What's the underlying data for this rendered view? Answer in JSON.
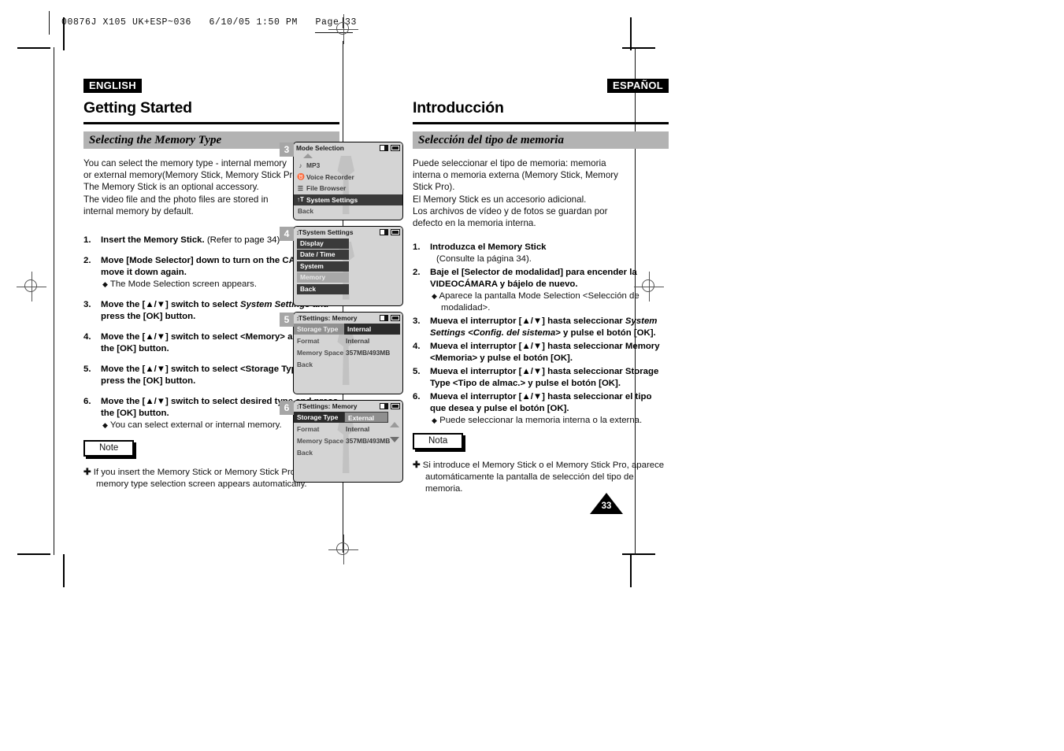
{
  "print_marks": {
    "header": "00876J X105 UK+ESP~036   6/10/05 1:50 PM   Page 33"
  },
  "left_column": {
    "lang_tag": "ENGLISH",
    "section_title": "Getting Started",
    "subhead": "Selecting the Memory Type",
    "intro_lines": [
      "You can select the memory type - internal memory",
      "or external memory(Memory Stick, Memory Stick Pro).",
      "The Memory Stick is an optional accessory.",
      "The video file and the photo files are stored in",
      "internal memory by default."
    ],
    "steps": [
      {
        "num": "1.",
        "bold": "Insert the Memory Stick.",
        "regular": " (Refer to page 34)",
        "bullets": []
      },
      {
        "num": "2.",
        "bold": "Move [Mode Selector] down to turn on the CAM and move it down again.",
        "regular": "",
        "bullets": [
          "The Mode Selection screen appears."
        ]
      },
      {
        "num": "3.",
        "bold_pre": "Move the [▲/▼] switch to select ",
        "italic": "System Settings",
        "bold_post": " and press the [OK] button.",
        "bullets": []
      },
      {
        "num": "4.",
        "bold": "Move the [▲/▼] switch to select <Memory> and press the [OK] button.",
        "regular": "",
        "bullets": []
      },
      {
        "num": "5.",
        "bold": "Move the [▲/▼] switch to select <Storage Type> and press the [OK] button.",
        "regular": "",
        "bullets": []
      },
      {
        "num": "6.",
        "bold": "Move the [▲/▼] switch to select desired type and press the [OK] button.",
        "regular": "",
        "bullets": [
          "You can select external or internal memory."
        ]
      }
    ],
    "note_label": "Note",
    "note_text": "If you insert the Memory Stick or Memory Stick Pro, the memory type selection screen appears automatically."
  },
  "right_column": {
    "lang_tag": "ESPAÑOL",
    "section_title": "Introducción",
    "subhead": "Selección del tipo de memoria",
    "intro_lines": [
      "Puede seleccionar el tipo de memoria: memoria",
      "interna o memoria externa (Memory Stick, Memory",
      "Stick Pro).",
      "El Memory Stick es un accesorio adicional.",
      "Los archivos de vídeo y de fotos se guardan por",
      "defecto en la memoria interna."
    ],
    "steps": [
      {
        "num": "1.",
        "bold": "Introduzca el Memory Stick",
        "regular": "",
        "sub_regular": "(Consulte la página 34).",
        "bullets": []
      },
      {
        "num": "2.",
        "bold": "Baje el [Selector de modalidad] para encender la VIDEOCÁMARA y bájelo de nuevo.",
        "regular": "",
        "bullets": [
          "Aparece la pantalla Mode Selection <Selección de modalidad>."
        ]
      },
      {
        "num": "3.",
        "bold_pre": "Mueva el interruptor [▲/▼] hasta seleccionar ",
        "italic": "System Settings <Config. del sistema>",
        "bold_post": " y pulse el botón [OK].",
        "bullets": []
      },
      {
        "num": "4.",
        "bold": "Mueva el interruptor [▲/▼] hasta seleccionar Memory <Memoria> y pulse el botón [OK].",
        "regular": "",
        "bullets": []
      },
      {
        "num": "5.",
        "bold": "Mueva el interruptor [▲/▼] hasta seleccionar Storage Type <Tipo de almac.> y pulse el botón [OK].",
        "regular": "",
        "bullets": []
      },
      {
        "num": "6.",
        "bold": "Mueva el interruptor [▲/▼] hasta seleccionar el tipo que desea y pulse el botón [OK].",
        "regular": "",
        "bullets": [
          "Puede seleccionar la memoria interna o la externa."
        ]
      }
    ],
    "note_label": "Nota",
    "note_text": "Si introduce el Memory Stick o el Memory Stick Pro, aparece automáticamente la pantalla de selección del tipo de memoria."
  },
  "lcd_panels": [
    {
      "step": "3",
      "title": "Mode Selection",
      "icons": [
        "card-icon",
        "battery-icon"
      ],
      "style": "list",
      "has_caret_up": true,
      "rows": [
        {
          "icon": "♪",
          "label": "MP3",
          "state": "normal"
        },
        {
          "icon": "♉",
          "label": "Voice Recorder",
          "state": "normal"
        },
        {
          "icon": "☰",
          "label": "File Browser",
          "state": "normal"
        },
        {
          "icon": "↑T",
          "label": "System Settings",
          "state": "selected"
        },
        {
          "icon": "",
          "label": "Back",
          "state": "plain"
        }
      ]
    },
    {
      "step": "4",
      "title": "System Settings",
      "title_icon": "gear-icon",
      "icons": [
        "card-icon",
        "battery-icon"
      ],
      "style": "boxed",
      "rows": [
        {
          "label": "Display",
          "state": "normal"
        },
        {
          "label": "Date / Time",
          "state": "normal"
        },
        {
          "label": "System",
          "state": "normal"
        },
        {
          "label": "Memory",
          "state": "highlight"
        },
        {
          "label": "Back",
          "state": "normal"
        }
      ]
    },
    {
      "step": "5",
      "title": "Settings: Memory",
      "title_icon": "gear-icon",
      "icons": [
        "card-icon",
        "battery-icon"
      ],
      "style": "settings",
      "has_scroll_arrows": false,
      "rows": [
        {
          "key": "Storage Type",
          "key_state": "on",
          "value": "Internal",
          "value_state": "dark"
        },
        {
          "key": "Format",
          "key_state": "off",
          "value": "Internal",
          "value_state": "plain"
        },
        {
          "key": "Memory Space",
          "key_state": "off",
          "value": "357MB/493MB",
          "value_state": "plain"
        },
        {
          "key": "Back",
          "key_state": "off",
          "value": "",
          "value_state": "plain"
        }
      ]
    },
    {
      "step": "6",
      "title": "Settings: Memory",
      "title_icon": "gear-icon",
      "icons": [
        "card-icon",
        "battery-icon"
      ],
      "style": "settings",
      "has_scroll_arrows": true,
      "rows": [
        {
          "key": "Storage Type",
          "key_state": "dark",
          "value": "External",
          "value_state": "gray"
        },
        {
          "key": "Format",
          "key_state": "off",
          "value": "Internal",
          "value_state": "plain"
        },
        {
          "key": "Memory Space",
          "key_state": "off",
          "value": "357MB/493MB",
          "value_state": "plain"
        },
        {
          "key": "Back",
          "key_state": "off",
          "value": "",
          "value_state": "plain"
        }
      ]
    }
  ],
  "page_number": "33"
}
